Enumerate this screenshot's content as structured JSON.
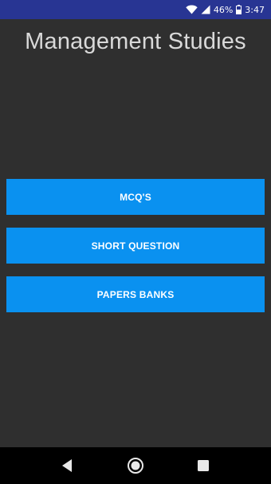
{
  "status_bar": {
    "battery_percent": "46%",
    "time": "3:47",
    "background": "#283593"
  },
  "page": {
    "title": "Management Studies"
  },
  "menu": {
    "buttons": [
      {
        "label": "MCQ'S"
      },
      {
        "label": "SHORT QUESTION"
      },
      {
        "label": "PAPERS BANKS"
      }
    ],
    "button_color": "#0a91f0"
  },
  "nav_bar": {
    "icons": [
      "back-icon",
      "home-icon",
      "recents-icon"
    ]
  }
}
